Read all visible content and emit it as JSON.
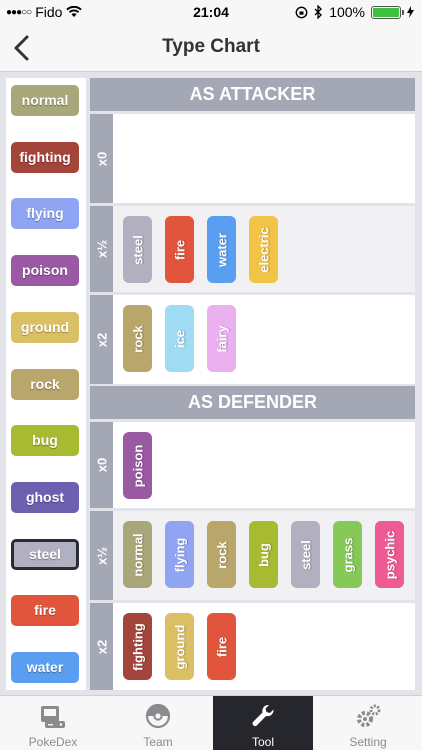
{
  "status": {
    "carrier": "Fido",
    "time": "21:04",
    "battery": "100%"
  },
  "nav": {
    "title": "Type Chart"
  },
  "type_list": [
    {
      "name": "normal",
      "color": "#a8a77a"
    },
    {
      "name": "fighting",
      "color": "#a4453b"
    },
    {
      "name": "flying",
      "color": "#8fa5f4"
    },
    {
      "name": "poison",
      "color": "#9a5aa3"
    },
    {
      "name": "ground",
      "color": "#dbbf65"
    },
    {
      "name": "rock",
      "color": "#b8a66b"
    },
    {
      "name": "bug",
      "color": "#a8b932"
    },
    {
      "name": "ghost",
      "color": "#6e60b1"
    },
    {
      "name": "steel",
      "color": "#b0b0c0"
    },
    {
      "name": "fire",
      "color": "#e2553d"
    },
    {
      "name": "water",
      "color": "#5a9ef2"
    }
  ],
  "selected_type": "steel",
  "attacker": {
    "title": "AS ATTACKER",
    "rows": [
      {
        "label": "x0",
        "types": []
      },
      {
        "label": "x½",
        "types": [
          {
            "name": "steel",
            "color": "#b0b0c0"
          },
          {
            "name": "fire",
            "color": "#e2553d"
          },
          {
            "name": "water",
            "color": "#5a9ef2"
          },
          {
            "name": "electric",
            "color": "#f1c447"
          }
        ]
      },
      {
        "label": "x2",
        "types": [
          {
            "name": "rock",
            "color": "#b8a66b"
          },
          {
            "name": "ice",
            "color": "#9fdcf4"
          },
          {
            "name": "fairy",
            "color": "#eab0f0"
          }
        ]
      }
    ]
  },
  "defender": {
    "title": "AS DEFENDER",
    "rows": [
      {
        "label": "x0",
        "types": [
          {
            "name": "poison",
            "color": "#9a5aa3"
          }
        ]
      },
      {
        "label": "x½",
        "types": [
          {
            "name": "normal",
            "color": "#a8a77a"
          },
          {
            "name": "flying",
            "color": "#8fa5f4"
          },
          {
            "name": "rock",
            "color": "#b8a66b"
          },
          {
            "name": "bug",
            "color": "#a8b932"
          },
          {
            "name": "steel",
            "color": "#b0b0c0"
          },
          {
            "name": "grass",
            "color": "#86c959"
          },
          {
            "name": "psychic",
            "color": "#ee5a94"
          }
        ]
      },
      {
        "label": "x2",
        "types": [
          {
            "name": "fighting",
            "color": "#a4453b"
          },
          {
            "name": "ground",
            "color": "#dbbf65"
          },
          {
            "name": "fire",
            "color": "#e2553d"
          }
        ]
      }
    ]
  },
  "tabs": [
    {
      "label": "PokeDex",
      "icon": "gameboy-icon",
      "active": false
    },
    {
      "label": "Team",
      "icon": "pokeball-icon",
      "active": false
    },
    {
      "label": "Tool",
      "icon": "wrench-icon",
      "active": true
    },
    {
      "label": "Setting",
      "icon": "gears-icon",
      "active": false
    }
  ]
}
